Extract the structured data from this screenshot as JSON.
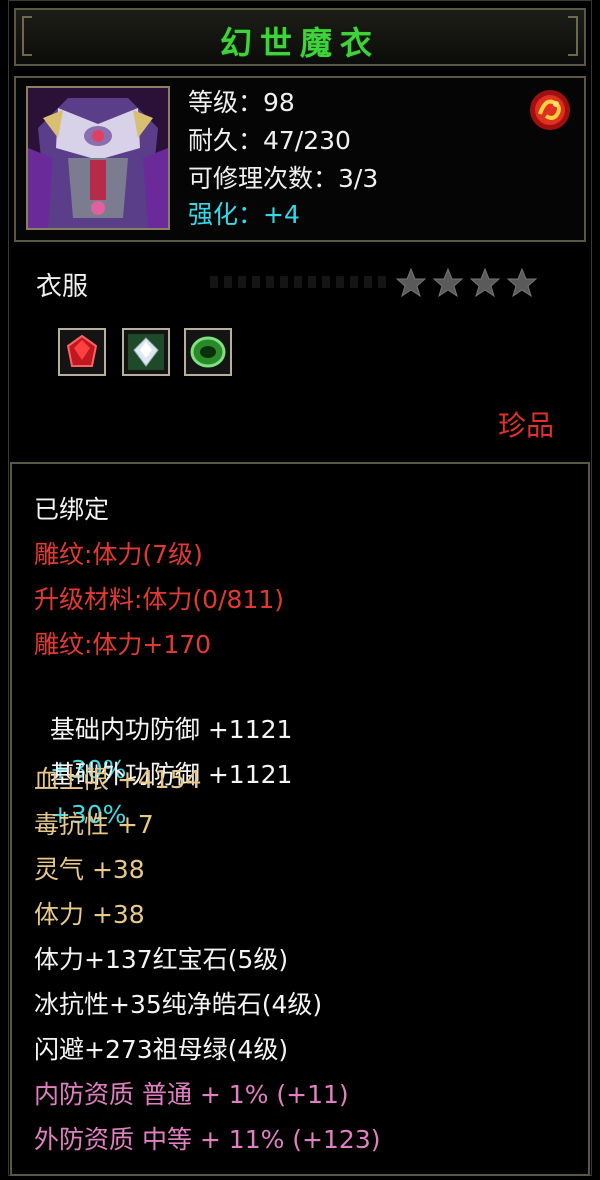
{
  "item": {
    "name": "幻世魔衣",
    "level_text": "等级：98",
    "durability_text": "耐久：47/230",
    "repair_text": "可修理次数：3/3",
    "enhance_text": "强化：+4",
    "type": "衣服",
    "stars": 4,
    "rarity": "珍品"
  },
  "gems": [
    {
      "icon": "ruby-gem-icon"
    },
    {
      "icon": "pure-diamond-gem-icon"
    },
    {
      "icon": "emerald-gem-icon"
    }
  ],
  "stats": {
    "bound": "已绑定",
    "engrave": "雕纹:体力(7级)",
    "upgrade_material": "升级材料:体力(0/811)",
    "engrave_bonus": "雕纹:体力+170",
    "inner_def": "基础内功防御 +1121",
    "inner_def_bonus": "+30%",
    "outer_def": "基础外功防御 +1121",
    "outer_def_bonus": "+30%",
    "hp_max": "血上限 +4154",
    "poison_res": "毒抗性 +7",
    "spirit": "灵气 +38",
    "stamina": "体力 +38",
    "gem_stamina": "体力+137红宝石(5级)",
    "gem_ice": "冰抗性+35纯净皓石(4级)",
    "gem_dodge": "闪避+273祖母绿(4级)",
    "inner_quality": "内防资质 普通 + 1% (+11)",
    "outer_quality": "外防资质 中等 + 11% (+123)"
  },
  "colors": {
    "title": "#3fd23a",
    "enhance": "#36d8e8",
    "red": "#e23a32",
    "gold": "#e8c98a",
    "pink": "#e080c0",
    "cyan": "#48d8e0"
  }
}
